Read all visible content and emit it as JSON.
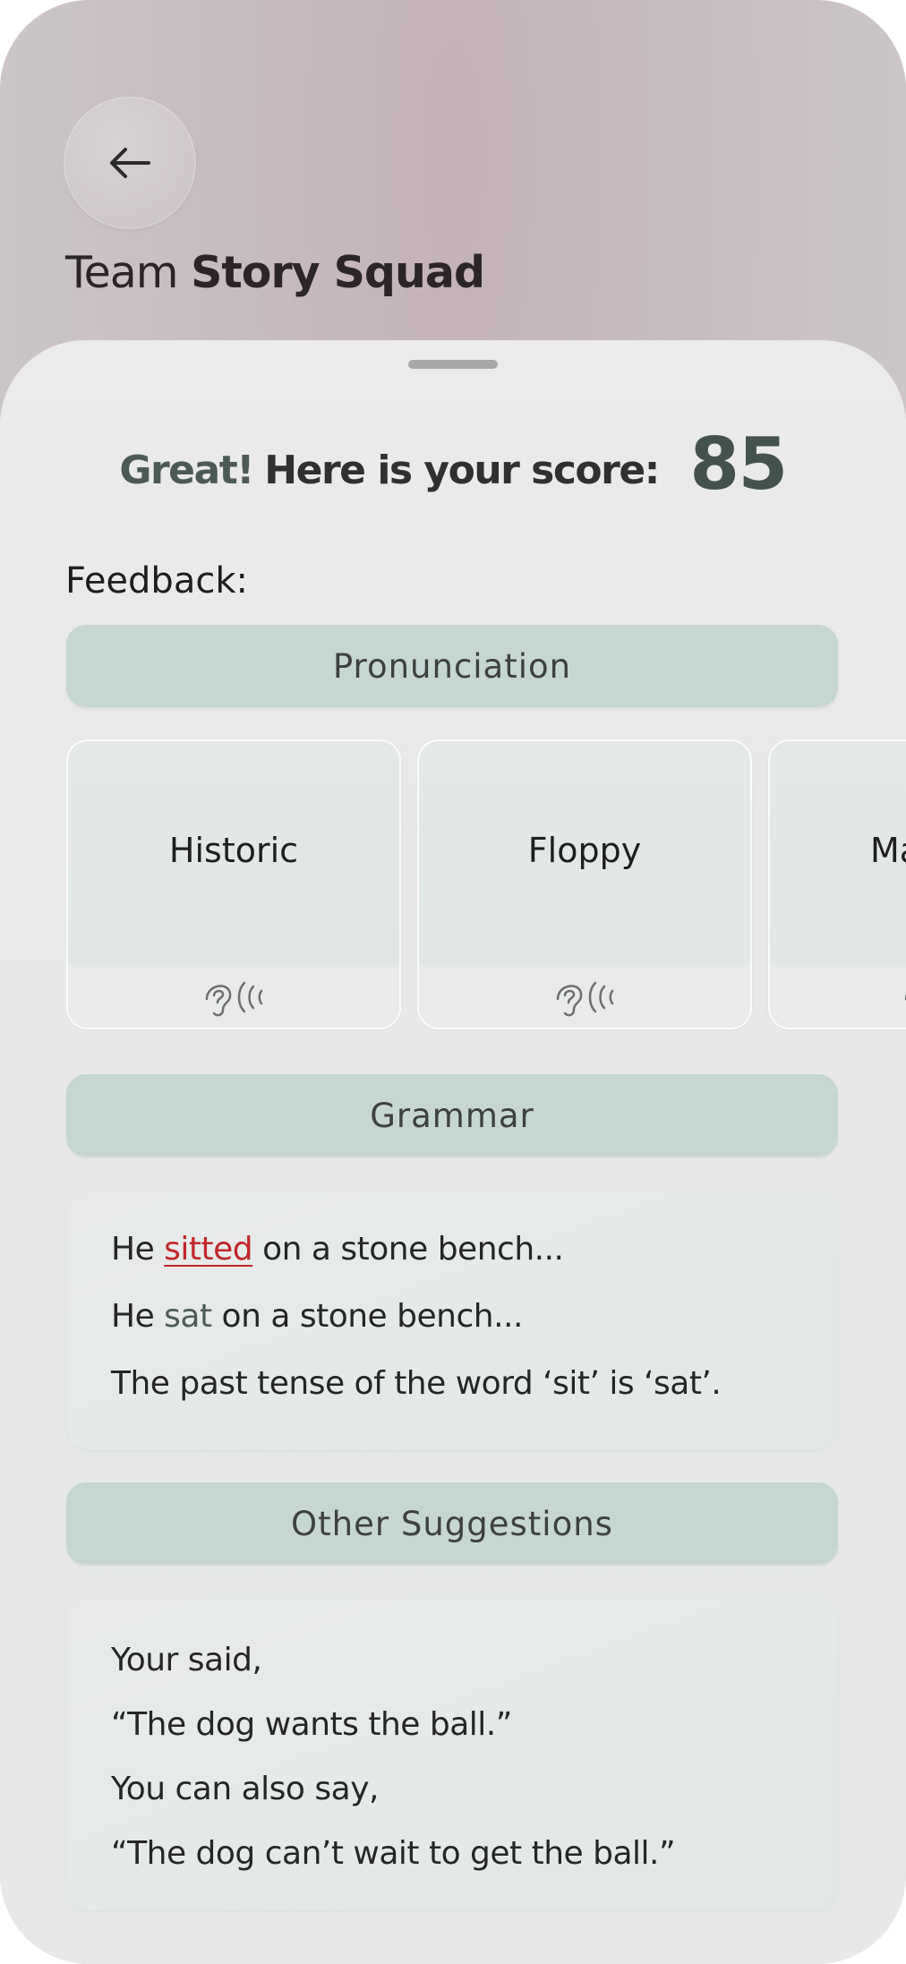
{
  "header": {
    "team_prefix": "Team",
    "team_name": "Story Squad"
  },
  "score": {
    "exclaim": "Great!",
    "label": "Here is your score:",
    "value": "85"
  },
  "feedback_label": "Feedback:",
  "sections": {
    "pronunciation": "Pronunciation",
    "grammar": "Grammar",
    "other": "Other Suggestions"
  },
  "pronunciation_cards": [
    {
      "word": "Historic",
      "icon": "listen-ear-icon"
    },
    {
      "word": "Floppy",
      "icon": "listen-ear-icon"
    },
    {
      "word": "Ma",
      "icon": "listen-ear-icon"
    }
  ],
  "grammar": {
    "line1_prefix": "He ",
    "line1_wrong": "sitted",
    "line1_suffix": " on a stone bench...",
    "line2_prefix": "He ",
    "line2_right": "sat",
    "line2_suffix": " on a stone bench...",
    "line3": "The past tense of the word ‘sit’ is ‘sat’."
  },
  "other": {
    "line1": "Your said,",
    "line2": "“The dog wants the ball.”",
    "line3": "You can also say,",
    "line4": "“The dog can’t wait to get the ball.”"
  },
  "colors": {
    "section_header": "#c6d6d3",
    "score_accent": "#44524d",
    "error": "#c0282a"
  }
}
